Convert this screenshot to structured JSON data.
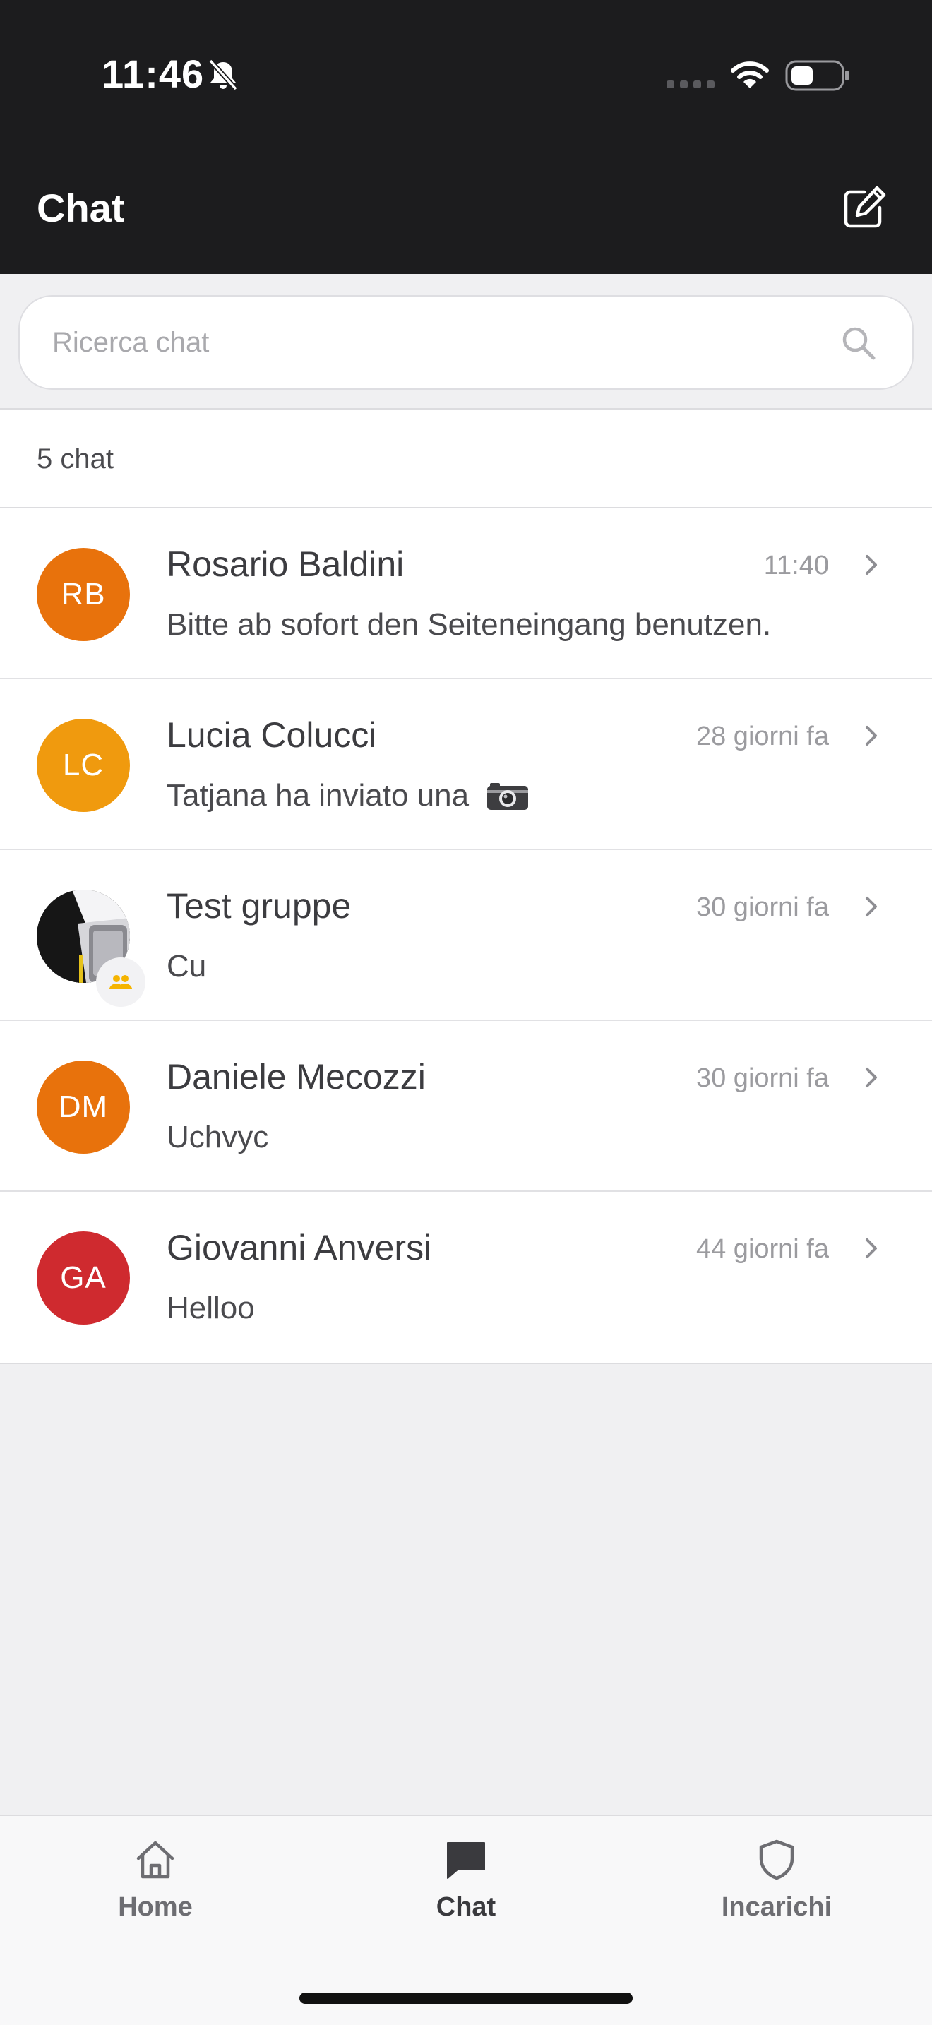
{
  "status_bar": {
    "time": "11:46",
    "icons": [
      "bell-slash-icon",
      "signal-icon",
      "wifi-icon",
      "battery-icon"
    ]
  },
  "header": {
    "title": "Chat",
    "compose_icon": "compose-icon"
  },
  "search": {
    "placeholder": "Ricerca chat",
    "value": "",
    "icon": "search-icon"
  },
  "summary": {
    "count_label": "5 chat"
  },
  "chats": [
    {
      "initials": "RB",
      "name": "Rosario Baldini",
      "time": "11:40",
      "preview": "Bitte ab sofort den Seiteneingang benutzen.",
      "avatar_color": "#e8720c"
    },
    {
      "initials": "LC",
      "name": "Lucia Colucci",
      "time": "28 giorni fa",
      "preview": "Tatjana ha inviato una",
      "preview_icon": "camera-icon",
      "avatar_color": "#f09a0e"
    },
    {
      "initials": "",
      "name": "Test gruppe",
      "time": "30 giorni fa",
      "preview": "Cu",
      "avatar": "photo",
      "badge_icon": "group-icon",
      "badge_color": "#f5b400"
    },
    {
      "initials": "DM",
      "name": "Daniele Mecozzi",
      "time": "30 giorni fa",
      "preview": "Uchvyc",
      "avatar_color": "#e8720c"
    },
    {
      "initials": "GA",
      "name": "Giovanni Anversi",
      "time": "44 giorni fa",
      "preview": "Helloo",
      "avatar_color": "#cf2a2f"
    }
  ],
  "tabbar": {
    "tabs": [
      {
        "label": "Home",
        "icon": "home-icon",
        "active": false
      },
      {
        "label": "Chat",
        "icon": "chat-bubble-icon",
        "active": true
      },
      {
        "label": "Incarichi",
        "icon": "shield-icon",
        "active": false
      }
    ]
  }
}
